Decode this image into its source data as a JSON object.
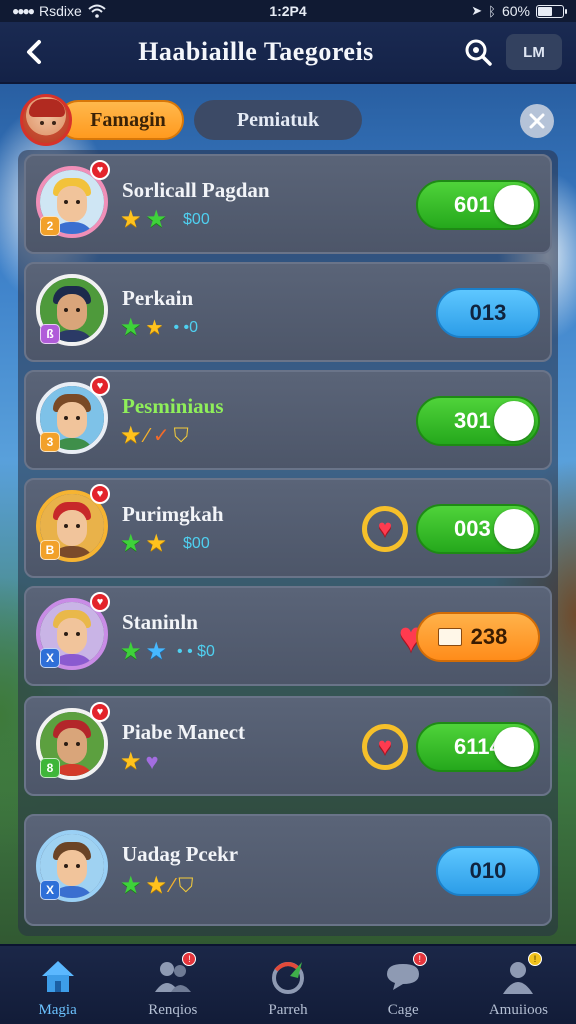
{
  "status_bar": {
    "carrier": "Rsdixe",
    "time": "1:2P4",
    "battery": "60%",
    "battery_level": 0.6
  },
  "header": {
    "title": "Haabiaille Taegoreis",
    "profile_label": "LM"
  },
  "filter_bar": {
    "tab_primary": "Famagin",
    "tab_secondary": "Pemiatuk"
  },
  "rows": [
    {
      "name": "Sorlicall Pagdan",
      "rank": "2",
      "stats_text": "$00",
      "control": "601",
      "control_type": "toggle-on"
    },
    {
      "name": "Perkain",
      "rank": "ß",
      "stats_text": "• •0",
      "control": "013",
      "control_type": "button-blue"
    },
    {
      "name": "Pesminiaus",
      "rank": "3",
      "stats_text": "",
      "control": "301",
      "control_type": "toggle-on"
    },
    {
      "name": "Purimgkah",
      "rank": "B",
      "stats_text": "$00",
      "control": "003",
      "control_type": "toggle-on"
    },
    {
      "name": "Staninln",
      "rank": "X",
      "stats_text": "• • $0",
      "control": "238",
      "control_type": "button-orange"
    },
    {
      "name": "Piabe Manect",
      "rank": "8",
      "stats_text": "",
      "control": "6114",
      "control_type": "toggle-on"
    },
    {
      "name": "Uadag Pcekr",
      "rank": "X",
      "stats_text": "",
      "control": "010",
      "control_type": "button-blue"
    }
  ],
  "bottom_nav": [
    {
      "label": "Magia",
      "active": true
    },
    {
      "label": "Renqios",
      "active": false
    },
    {
      "label": "Parreh",
      "active": false
    },
    {
      "label": "Cage",
      "active": false
    },
    {
      "label": "Amuiioos",
      "active": false
    }
  ],
  "colors": {
    "accent_green": "#25a81c",
    "accent_blue": "#2c9de8",
    "accent_orange": "#ff8c1a",
    "header_bg": "#1a2a52",
    "nav_active": "#6cc3ff"
  },
  "icons": {
    "back": "chevron-left-icon",
    "search": "search-icon",
    "close": "close-icon",
    "heart": "heart-icon",
    "star": "star-icon",
    "envelope": "envelope-icon",
    "home": "home-icon"
  }
}
